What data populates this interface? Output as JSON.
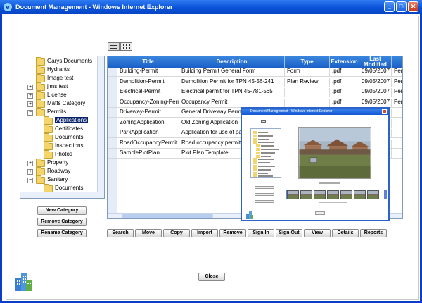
{
  "window": {
    "title": "Document Management - Windows Internet Explorer",
    "ie_glyph": "e",
    "minimize_glyph": "_",
    "maximize_glyph": "□",
    "close_glyph": "✕"
  },
  "tree": {
    "items": [
      {
        "label": "Garys Documents",
        "level": 1,
        "expander": "",
        "selected": false
      },
      {
        "label": "Hydrants",
        "level": 1,
        "expander": "",
        "selected": false
      },
      {
        "label": "Image test",
        "level": 1,
        "expander": "",
        "selected": false
      },
      {
        "label": "jims test",
        "level": 1,
        "expander": "+",
        "selected": false
      },
      {
        "label": "License",
        "level": 1,
        "expander": "+",
        "selected": false
      },
      {
        "label": "Matts Category",
        "level": 1,
        "expander": "+",
        "selected": false
      },
      {
        "label": "Permits",
        "level": 1,
        "expander": "−",
        "selected": false
      },
      {
        "label": "Applications",
        "level": 2,
        "expander": "",
        "selected": true
      },
      {
        "label": "Certificates",
        "level": 2,
        "expander": "",
        "selected": false
      },
      {
        "label": "Documents",
        "level": 2,
        "expander": "",
        "selected": false
      },
      {
        "label": "Inspections",
        "level": 2,
        "expander": "",
        "selected": false
      },
      {
        "label": "Photos",
        "level": 2,
        "expander": "",
        "selected": false
      },
      {
        "label": "Property",
        "level": 1,
        "expander": "+",
        "selected": false
      },
      {
        "label": "Roadway",
        "level": 1,
        "expander": "+",
        "selected": false
      },
      {
        "label": "Sanitary",
        "level": 1,
        "expander": "−",
        "selected": false
      },
      {
        "label": "Documents",
        "level": 2,
        "expander": "",
        "selected": false
      }
    ]
  },
  "category_buttons": {
    "new": "New Category",
    "remove": "Remove Category",
    "rename": "Rename Category"
  },
  "grid": {
    "columns": [
      "Title",
      "Description",
      "Type",
      "Extension",
      "Last Modified"
    ],
    "rows": [
      [
        "Building-Permit",
        "Building Permit General Form",
        "Form",
        ".pdf",
        "09/05/2007",
        "Pern"
      ],
      [
        "Demolition-Permit",
        "Demolition Permit for TPN 45-56-241",
        "Plan Review",
        ".pdf",
        "09/05/2007",
        "Pern"
      ],
      [
        "Electrical-Permit",
        "Electrical permit for TPN 45-781-565",
        "",
        ".pdf",
        "09/05/2007",
        "Pern"
      ],
      [
        "Occupancy-Zoning-Permit",
        "Occupancy Permit",
        "",
        ".pdf",
        "09/05/2007",
        "Pern"
      ],
      [
        "Driveway-Permit",
        "General Driveway Perm",
        "",
        "",
        "",
        ""
      ],
      [
        "ZoningApplication",
        "Old Zoning Application",
        "",
        "",
        "",
        ""
      ],
      [
        "ParkApplication",
        "Application for use of pa",
        "",
        "",
        "",
        ""
      ],
      [
        "RoadOccupancyPermit",
        "Road occupancy permit f",
        "",
        "",
        "",
        ""
      ],
      [
        "SamplePlotPlan",
        "Plot Plan Template",
        "",
        "",
        "",
        ""
      ]
    ]
  },
  "actions": [
    "Search",
    "Move",
    "Copy",
    "Import",
    "Remove",
    "Sign In",
    "Sign Out",
    "View",
    "Details",
    "Reports"
  ],
  "preview": {
    "title": "Document Management - Windows Internet Explorer"
  },
  "close_button": "Close",
  "colors": {
    "titlebar": "#0a52d8",
    "grid_header": "#1a60c8",
    "selection": "#0a246a"
  }
}
